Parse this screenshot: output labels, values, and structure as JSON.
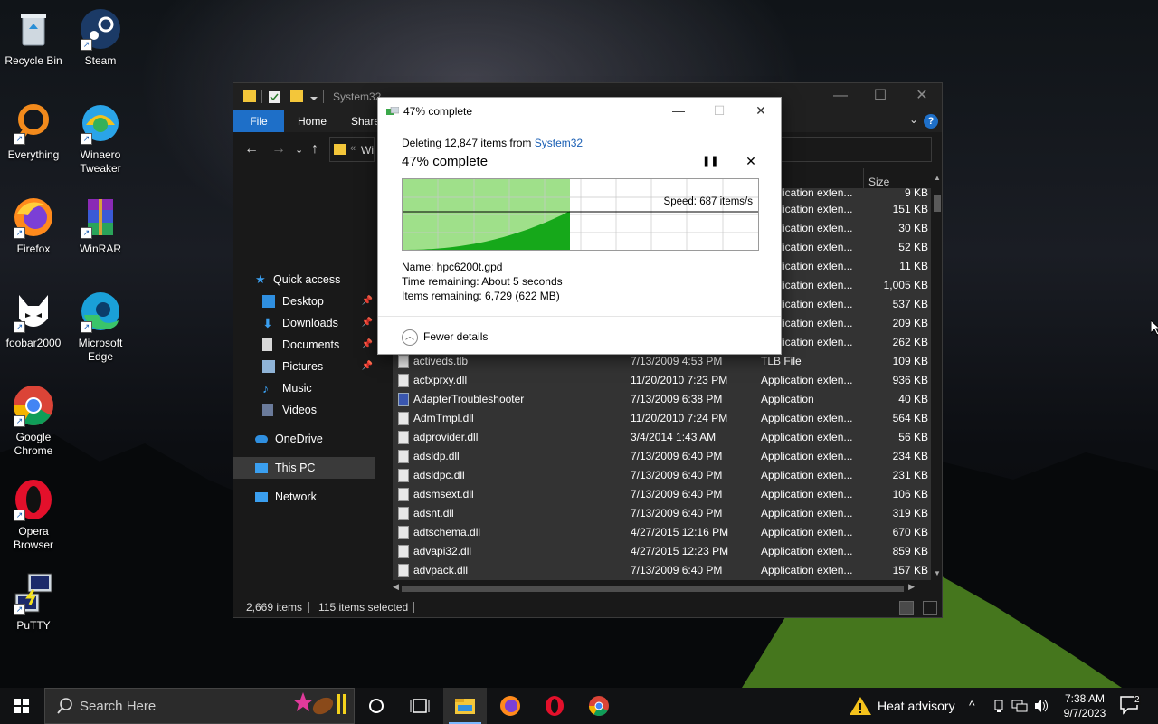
{
  "desktop_icons": [
    {
      "label": "Recycle Bin",
      "icon": "recycle-bin-icon"
    },
    {
      "label": "Steam",
      "icon": "steam-icon"
    },
    {
      "label": "Everything",
      "icon": "everything-search-icon"
    },
    {
      "label": "Winaero Tweaker",
      "icon": "winaero-tweaker-icon"
    },
    {
      "label": "Firefox",
      "icon": "firefox-icon"
    },
    {
      "label": "WinRAR",
      "icon": "winrar-icon"
    },
    {
      "label": "foobar2000",
      "icon": "foobar2000-icon"
    },
    {
      "label": "Microsoft Edge",
      "icon": "edge-icon"
    },
    {
      "label": "Google Chrome",
      "icon": "chrome-icon"
    },
    {
      "label": "Opera Browser",
      "icon": "opera-icon"
    },
    {
      "label": "PuTTY",
      "icon": "putty-icon"
    }
  ],
  "explorer": {
    "title": "System32",
    "ribbon_tabs": [
      "File",
      "Home",
      "Share"
    ],
    "address_prefix": "Wi",
    "nav": [
      {
        "label": "Quick access",
        "icon": "star-icon"
      },
      {
        "label": "Desktop",
        "icon": "desktop-folder-icon",
        "pinned": true
      },
      {
        "label": "Downloads",
        "icon": "downloads-folder-icon",
        "pinned": true
      },
      {
        "label": "Documents",
        "icon": "documents-folder-icon",
        "pinned": true
      },
      {
        "label": "Pictures",
        "icon": "pictures-folder-icon",
        "pinned": true
      },
      {
        "label": "Music",
        "icon": "music-folder-icon"
      },
      {
        "label": "Videos",
        "icon": "videos-folder-icon"
      },
      {
        "label": "OneDrive",
        "icon": "onedrive-icon"
      },
      {
        "label": "This PC",
        "icon": "this-pc-icon",
        "selected": true
      },
      {
        "label": "Network",
        "icon": "network-icon"
      }
    ],
    "column_size": "Size",
    "partial_rows": [
      {
        "type": "Application exten...",
        "size": "9 KB"
      },
      {
        "type": "Application exten...",
        "size": "151 KB"
      },
      {
        "type": "Application exten...",
        "size": "30 KB"
      },
      {
        "type": "Application exten...",
        "size": "52 KB"
      },
      {
        "type": "Application exten...",
        "size": "11 KB"
      },
      {
        "type": "Application exten...",
        "size": "1,005 KB"
      },
      {
        "type": "Application exten...",
        "size": "537 KB"
      },
      {
        "type": "Application exten...",
        "size": "209 KB"
      },
      {
        "type": "Application exten...",
        "size": "262 KB"
      }
    ],
    "rows": [
      {
        "name": "activeds.tlb",
        "date": "7/13/2009 4:53 PM",
        "type": "TLB File",
        "size": "109 KB"
      },
      {
        "name": "actxprxy.dll",
        "date": "11/20/2010 7:23 PM",
        "type": "Application exten...",
        "size": "936 KB"
      },
      {
        "name": "AdapterTroubleshooter",
        "date": "7/13/2009 6:38 PM",
        "type": "Application",
        "size": "40 KB"
      },
      {
        "name": "AdmTmpl.dll",
        "date": "11/20/2010 7:24 PM",
        "type": "Application exten...",
        "size": "564 KB"
      },
      {
        "name": "adprovider.dll",
        "date": "3/4/2014 1:43 AM",
        "type": "Application exten...",
        "size": "56 KB"
      },
      {
        "name": "adsldp.dll",
        "date": "7/13/2009 6:40 PM",
        "type": "Application exten...",
        "size": "234 KB"
      },
      {
        "name": "adsldpc.dll",
        "date": "7/13/2009 6:40 PM",
        "type": "Application exten...",
        "size": "231 KB"
      },
      {
        "name": "adsmsext.dll",
        "date": "7/13/2009 6:40 PM",
        "type": "Application exten...",
        "size": "106 KB"
      },
      {
        "name": "adsnt.dll",
        "date": "7/13/2009 6:40 PM",
        "type": "Application exten...",
        "size": "319 KB"
      },
      {
        "name": "adtschema.dll",
        "date": "4/27/2015 12:16 PM",
        "type": "Application exten...",
        "size": "670 KB"
      },
      {
        "name": "advapi32.dll",
        "date": "4/27/2015 12:23 PM",
        "type": "Application exten...",
        "size": "859 KB"
      },
      {
        "name": "advpack.dll",
        "date": "7/13/2009 6:40 PM",
        "type": "Application exten...",
        "size": "157 KB"
      }
    ],
    "status_items": "2,669 items",
    "status_selected": "115 items selected"
  },
  "dialog": {
    "title": "47% complete",
    "line_prefix": "Deleting 12,847 items from ",
    "line_link": "System32",
    "heading": "47% complete",
    "progress_fraction": 0.47,
    "speed": "Speed: 687 items/s",
    "name": "Name:  hpc6200t.gpd",
    "time_remaining": "Time remaining:  About 5 seconds",
    "items_remaining": "Items remaining:  6,729 (622 MB)",
    "fewer_details": "Fewer details"
  },
  "taskbar": {
    "search_placeholder": "Search Here",
    "weather": "Heat advisory",
    "time": "7:38 AM",
    "date": "9/7/2023",
    "notification_count": "2",
    "apps": [
      "task-view-icon",
      "file-explorer-icon",
      "firefox-icon",
      "opera-icon",
      "chrome-icon"
    ]
  },
  "colors": {
    "accent": "#1e6fc8",
    "progress_fill": "#7ddc6e",
    "progress_graph": "#16a81a",
    "explorer_bg": "#191919"
  }
}
